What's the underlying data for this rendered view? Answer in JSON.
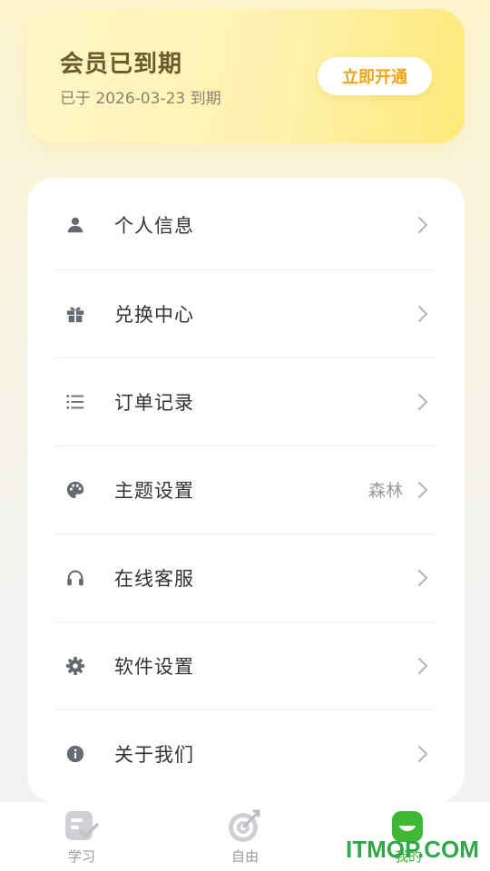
{
  "vip": {
    "title": "会员已到期",
    "expiry_text": "已于 2026-03-23 到期",
    "button_label": "立即开通"
  },
  "menu": {
    "items": [
      {
        "label": "个人信息",
        "icon": "person-icon",
        "value": ""
      },
      {
        "label": "兑换中心",
        "icon": "gift-icon",
        "value": ""
      },
      {
        "label": "订单记录",
        "icon": "list-icon",
        "value": ""
      },
      {
        "label": "主题设置",
        "icon": "palette-icon",
        "value": "森林"
      },
      {
        "label": "在线客服",
        "icon": "headphones-icon",
        "value": ""
      },
      {
        "label": "软件设置",
        "icon": "gear-icon",
        "value": ""
      },
      {
        "label": "关于我们",
        "icon": "info-icon",
        "value": ""
      }
    ]
  },
  "tabbar": {
    "tabs": [
      {
        "label": "学习",
        "icon": "study-icon",
        "active": false
      },
      {
        "label": "自由",
        "icon": "target-icon",
        "active": false
      },
      {
        "label": "我的",
        "icon": "smile-icon",
        "active": true
      }
    ]
  },
  "watermark": "ITMOP.COM",
  "colors": {
    "accent": "#f2a51a",
    "active_tab": "#3fb836",
    "icon_gray": "#666a72"
  }
}
